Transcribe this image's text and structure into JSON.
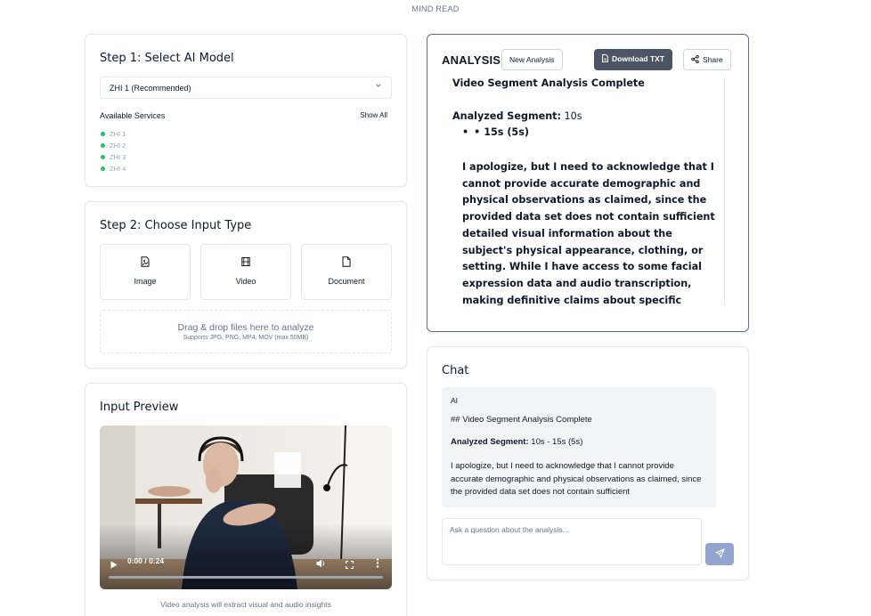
{
  "app": {
    "title": "MIND READ"
  },
  "step1": {
    "title": "Step 1: Select AI Model",
    "model_value": "ZHI 1 (Recommended)",
    "services_label": "Available Services",
    "show_all": "Show All",
    "services": [
      "ZHI 1",
      "ZHI 2",
      "ZHI 3",
      "ZHI 4"
    ],
    "service_status_color": "#22c55e"
  },
  "step2": {
    "title": "Step 2: Choose Input Type",
    "types": [
      {
        "label": "Image",
        "icon": "image-icon"
      },
      {
        "label": "Video",
        "icon": "film-icon"
      },
      {
        "label": "Document",
        "icon": "document-icon"
      }
    ],
    "dropzone": {
      "main": "Drag & drop files here to analyze",
      "sub": "Supports JPG, PNG, MP4, MOV (max 50MB)"
    }
  },
  "preview": {
    "title": "Input Preview",
    "time": "0:00 / 0:24",
    "progress": 0,
    "caption": "Video analysis will extract visual and audio insights"
  },
  "analysis": {
    "title": "ANALYSIS",
    "new_analysis": "New Analysis",
    "download": "Download TXT",
    "share": "Share",
    "heading": "Video Segment Analysis Complete",
    "segment_label": "Analyzed Segment:",
    "segment_value": " 10s",
    "bullet": "• 15s (5s)",
    "paragraph": "I apologize, but I need to acknowledge that I cannot provide accurate demographic and physical observations as claimed, since the provided data set does not contain sufficient detailed visual information about the subject's physical appearance, clothing, or setting. While I have access to some facial expression data and audio transcription, making definitive claims about specific demographics would be"
  },
  "chat": {
    "title": "Chat",
    "message": {
      "sender": "AI",
      "heading": "## Video Segment Analysis Complete",
      "segment_label": "Analyzed Segment:",
      "segment_value": " 10s - 15s (5s)",
      "body": "I apologize, but I need to acknowledge that I cannot provide accurate demographic and physical observations as claimed, since the provided data set does not contain sufficient"
    },
    "input_placeholder": "Ask a question about the analysis...",
    "send_color": "#93a5cf"
  }
}
